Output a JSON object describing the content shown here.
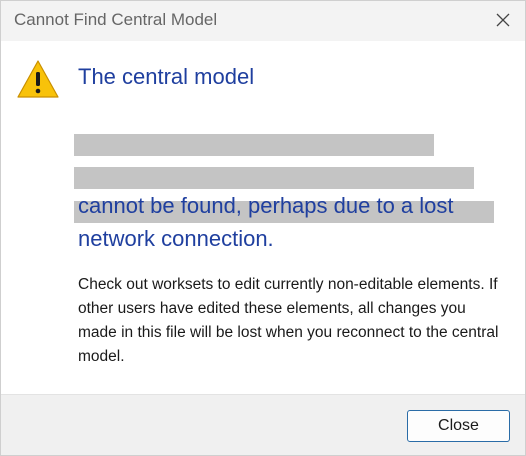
{
  "window": {
    "title": "Cannot Find Central Model"
  },
  "message": {
    "heading": "The central model",
    "heading_tail": "cannot be found, perhaps due to a lost network connection.",
    "body": "Check out worksets to edit currently non-editable elements.  If other users have edited these elements, all changes you made in this file will be lost when you reconnect to the central model."
  },
  "footer": {
    "close_label": "Close"
  },
  "icons": {
    "warning": "warning-icon",
    "close": "close-icon"
  },
  "colors": {
    "heading": "#1f3f9f",
    "warning_fill": "#f8c20a",
    "button_border": "#2a6ca7"
  }
}
